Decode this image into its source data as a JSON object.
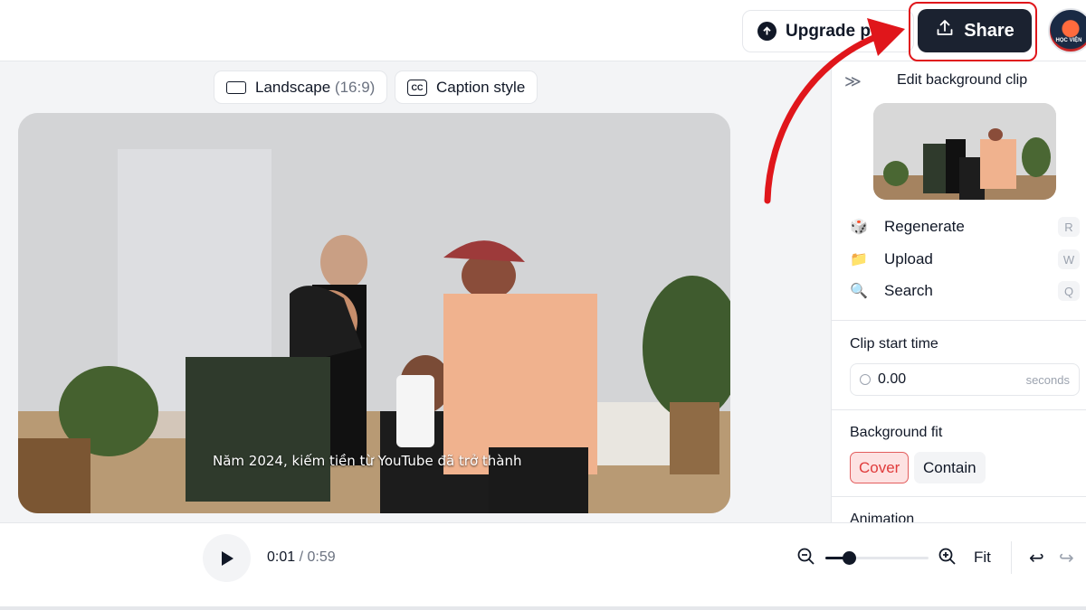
{
  "header": {
    "upgrade_label": "Upgrade plan",
    "share_label": "Share",
    "avatar_text": "HỌC VIỆN"
  },
  "stage": {
    "aspect_label": "Landscape",
    "aspect_ratio": "(16:9)",
    "caption_label": "Caption style",
    "subtitle": "Năm 2024, kiếm tiền từ YouTube đã trở thành"
  },
  "panel": {
    "title": "Edit background clip",
    "actions": [
      {
        "label": "Regenerate",
        "icon": "dice-icon",
        "shortcut": "R"
      },
      {
        "label": "Upload",
        "icon": "folder-icon",
        "shortcut": "W"
      },
      {
        "label": "Search",
        "icon": "magnifier-icon",
        "shortcut": "Q"
      }
    ],
    "clip_start_label": "Clip start time",
    "clip_start_value": "0.00",
    "clip_start_unit": "seconds",
    "background_fit_label": "Background fit",
    "fit_options": [
      "Cover",
      "Contain"
    ],
    "fit_selected": "Cover",
    "animation_label": "Animation"
  },
  "footer": {
    "current_time": "0:01",
    "separator": " / ",
    "duration": "0:59",
    "fit_label": "Fit",
    "zoom_level": 0.23
  },
  "colors": {
    "share_bg": "#1b2230",
    "highlight": "#e0161b",
    "cover_accent": "#e03b3b"
  }
}
